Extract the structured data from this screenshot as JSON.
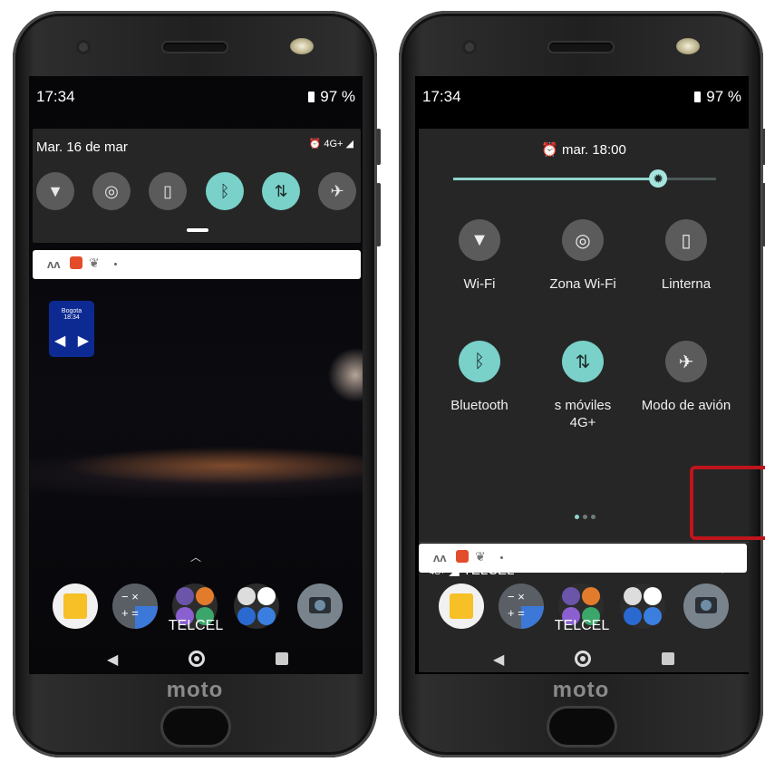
{
  "phone_left": {
    "status": {
      "time": "17:34",
      "battery": "97 %"
    },
    "quick_settings": {
      "date": "Mar. 16 de mar",
      "status_icons": "4G+",
      "tiles": [
        {
          "icon": "wifi-icon",
          "glyph": "▼",
          "active": false
        },
        {
          "icon": "hotspot-icon",
          "glyph": "◎",
          "active": false
        },
        {
          "icon": "flashlight-icon",
          "glyph": "▯",
          "active": false
        },
        {
          "icon": "bluetooth-icon",
          "glyph": "ᛒ",
          "active": true
        },
        {
          "icon": "mobile-data-icon",
          "glyph": "⇅",
          "active": true
        },
        {
          "icon": "airplane-icon",
          "glyph": "✈",
          "active": false
        }
      ]
    },
    "widget": {
      "city": "Bogota",
      "time": "18:34"
    },
    "dock_label": "TELCEL",
    "logo": "moto"
  },
  "phone_right": {
    "status": {
      "time": "17:34",
      "battery": "97 %"
    },
    "alarm": "mar. 18:00",
    "brightness_level": 0.78,
    "tiles": [
      {
        "label": "Wi-Fi",
        "icon": "wifi-icon",
        "glyph": "▼",
        "active": false
      },
      {
        "label": "Zona Wi-Fi",
        "icon": "hotspot-icon",
        "glyph": "◎",
        "active": false
      },
      {
        "label": "Linterna",
        "icon": "flashlight-icon",
        "glyph": "▯",
        "active": false
      },
      {
        "label": "Bluetooth",
        "icon": "bluetooth-icon",
        "glyph": "ᛒ",
        "active": true
      },
      {
        "label": "s móviles",
        "sublabel": "4G+",
        "icon": "mobile-data-icon",
        "glyph": "⇅",
        "active": true
      },
      {
        "label": "Modo de avión",
        "icon": "airplane-icon",
        "glyph": "✈",
        "active": false
      }
    ],
    "carrier": {
      "network": "4G+",
      "name": "TELCEL"
    },
    "dock_label": "TELCEL",
    "logo": "moto"
  },
  "colors": {
    "accent": "#79d1c9",
    "highlight": "#c0141c",
    "panel": "#262626"
  }
}
